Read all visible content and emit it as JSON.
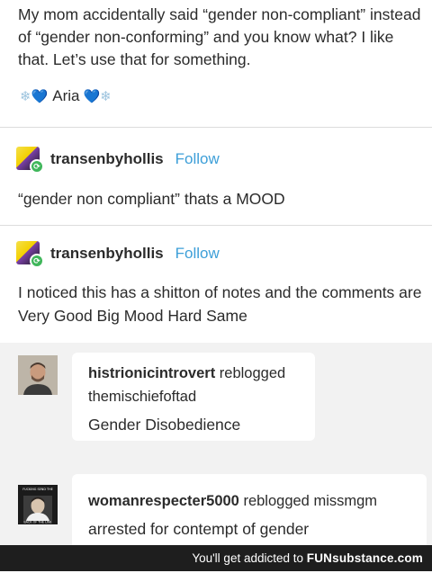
{
  "op": {
    "text": "My mom accidentally said “gender non-compliant” instead of “gender non-conforming” and you know what? I like that. Let’s use that for something.",
    "signature": {
      "name": "Aria",
      "left": [
        "❄",
        "💙"
      ],
      "right": [
        "💙",
        "❄"
      ]
    }
  },
  "replies": [
    {
      "username": "transenbyhollis",
      "follow_label": "Follow",
      "text": "“gender non compliant” thats a MOOD"
    },
    {
      "username": "transenbyhollis",
      "follow_label": "Follow",
      "text": "I noticed this has a shitton of notes and the comments are Very Good Big Mood Hard Same"
    }
  ],
  "notes": [
    {
      "user": "histrionicintrovert",
      "action": "reblogged",
      "source": "themischiefoftad",
      "comment": "Gender Disobedience"
    },
    {
      "user": "womanrespecter5000",
      "action": "reblogged",
      "source": "missmgm",
      "comment": "arrested for contempt of gender",
      "avatar_caption_top": "FUCKING SEND THE",
      "avatar_caption_bottom": "BACK OF THE LINE"
    }
  ],
  "watermark": {
    "prefix": "You'll get addicted to ",
    "brand": "FUNsubstance.com"
  }
}
